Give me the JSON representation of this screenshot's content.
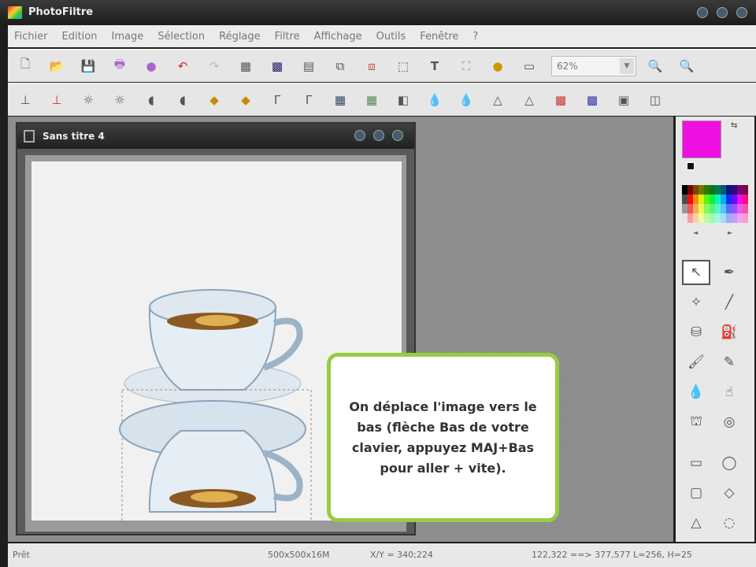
{
  "app": {
    "title": "PhotoFiltre"
  },
  "menu": [
    "Fichier",
    "Edition",
    "Image",
    "Sélection",
    "Réglage",
    "Filtre",
    "Affichage",
    "Outils",
    "Fenêtre",
    "?"
  ],
  "toolbar": {
    "zoom_value": "62%"
  },
  "document": {
    "title": "Sans titre 4"
  },
  "callout": {
    "text": "On déplace l'image vers le bas (flèche Bas de votre clavier, appuyez MAJ+Bas pour aller + vite)."
  },
  "colors": {
    "foreground": "#ee10e0",
    "accent_border": "#9acb44"
  },
  "status": {
    "state": "Prêt",
    "image_size": "500x500x16M",
    "cursor": "X/Y = 340;224",
    "selection": "122,322 ==> 377,577 L=256, H=25"
  }
}
